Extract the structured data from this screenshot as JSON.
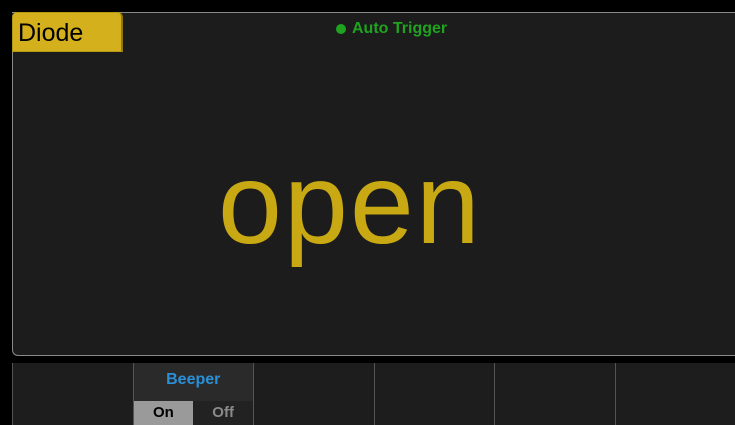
{
  "header": {
    "mode_label": "Diode",
    "trigger_label": "Auto  Trigger"
  },
  "display": {
    "reading": "open"
  },
  "softkeys": [
    {
      "label": ""
    },
    {
      "label": "Beeper",
      "options": [
        "On",
        "Off"
      ],
      "selected": "On"
    },
    {
      "label": ""
    },
    {
      "label": ""
    },
    {
      "label": ""
    },
    {
      "label": ""
    }
  ],
  "colors": {
    "accent_yellow": "#d4b11c",
    "reading": "#c8a914",
    "trigger_green": "#1fa31f",
    "softkey_label": "#2a8fd6"
  }
}
